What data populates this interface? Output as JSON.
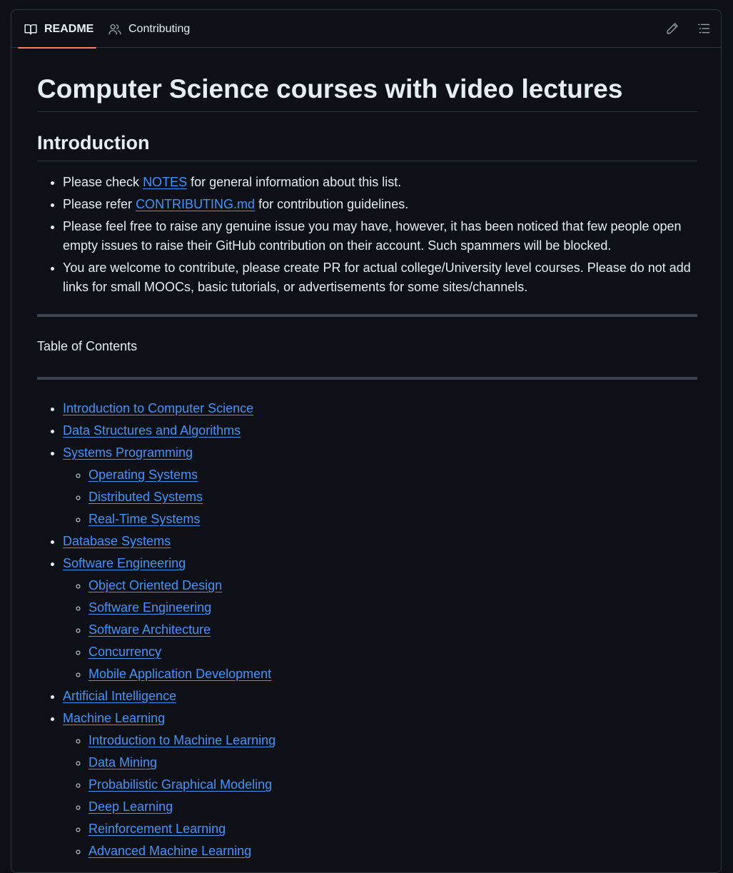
{
  "tabs": {
    "readme": {
      "label": "README",
      "icon": "book-icon"
    },
    "contributing": {
      "label": "Contributing",
      "icon": "people-icon"
    }
  },
  "toolbar": {
    "edit_icon": "pencil-icon",
    "outline_icon": "list-icon"
  },
  "article": {
    "title": "Computer Science courses with video lectures",
    "intro_heading": "Introduction",
    "intro": {
      "b1_pre": "Please check ",
      "b1_link": "NOTES",
      "b1_post": " for general information about this list.",
      "b2_pre": "Please refer ",
      "b2_link": "CONTRIBUTING.md",
      "b2_post": " for contribution guidelines.",
      "b3": "Please feel free to raise any genuine issue you may have, however, it has been noticed that few people open empty issues to raise their GitHub contribution on their account. Such spammers will be blocked.",
      "b4": "You are welcome to contribute, please create PR for actual college/University level courses. Please do not add links for small MOOCs, basic tutorials, or advertisements for some sites/channels."
    },
    "toc_title": "Table of Contents",
    "toc": [
      {
        "label": "Introduction to Computer Science",
        "children": []
      },
      {
        "label": "Data Structures and Algorithms",
        "children": []
      },
      {
        "label": "Systems Programming",
        "children": [
          "Operating Systems",
          "Distributed Systems",
          "Real-Time Systems"
        ]
      },
      {
        "label": "Database Systems",
        "children": []
      },
      {
        "label": "Software Engineering",
        "children": [
          "Object Oriented Design",
          "Software Engineering",
          "Software Architecture",
          "Concurrency",
          "Mobile Application Development"
        ]
      },
      {
        "label": "Artificial Intelligence",
        "children": []
      },
      {
        "label": "Machine Learning",
        "children": [
          "Introduction to Machine Learning",
          "Data Mining",
          "Probabilistic Graphical Modeling",
          "Deep Learning",
          "Reinforcement Learning",
          "Advanced Machine Learning"
        ]
      }
    ]
  },
  "colors": {
    "background": "#0d1117",
    "link": "#4493f8",
    "tab_underline": "#f78166",
    "border": "#30363d"
  }
}
